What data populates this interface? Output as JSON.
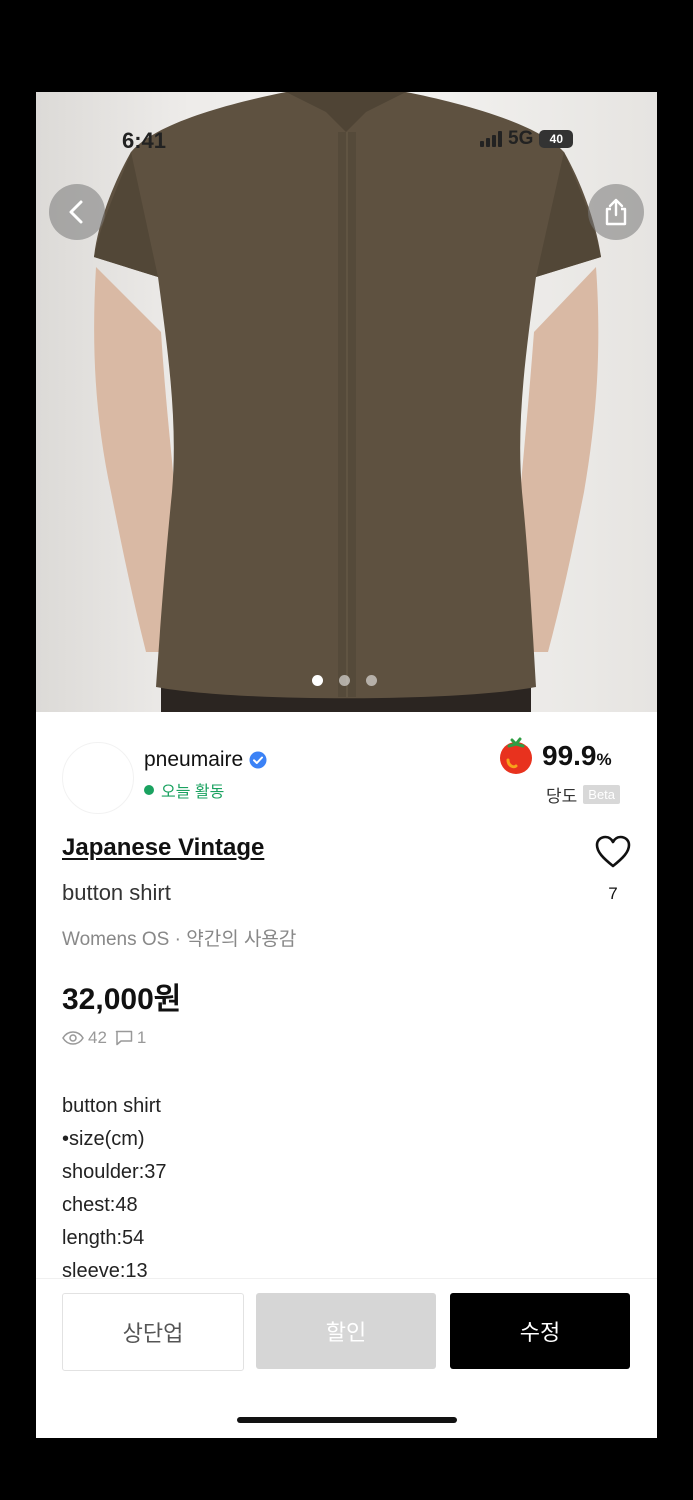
{
  "status_bar": {
    "time": "6:41",
    "network": "5G",
    "battery": "40"
  },
  "hero": {
    "page_count": 3,
    "active_page": 1
  },
  "seller": {
    "name": "pneumaire",
    "activity": "오늘 활동",
    "score_value": "99.9",
    "score_unit": "%",
    "score_label": "당도",
    "score_badge": "Beta"
  },
  "product": {
    "brand": "Japanese Vintage",
    "title": "button shirt",
    "meta": "Womens OS · 약간의 사용감",
    "price": "32,000원",
    "likes": "7",
    "views": "42",
    "chats": "1",
    "description": [
      "button shirt",
      "•size(cm)",
      "shoulder:37",
      "chest:48",
      "length:54",
      "sleeve:13"
    ]
  },
  "actions": {
    "bump_label": "상단업",
    "discount_label": "할인",
    "edit_label": "수정"
  },
  "colors": {
    "verified": "#3b82f6",
    "active_green": "#1aa260",
    "shirt": "#5e5140"
  }
}
